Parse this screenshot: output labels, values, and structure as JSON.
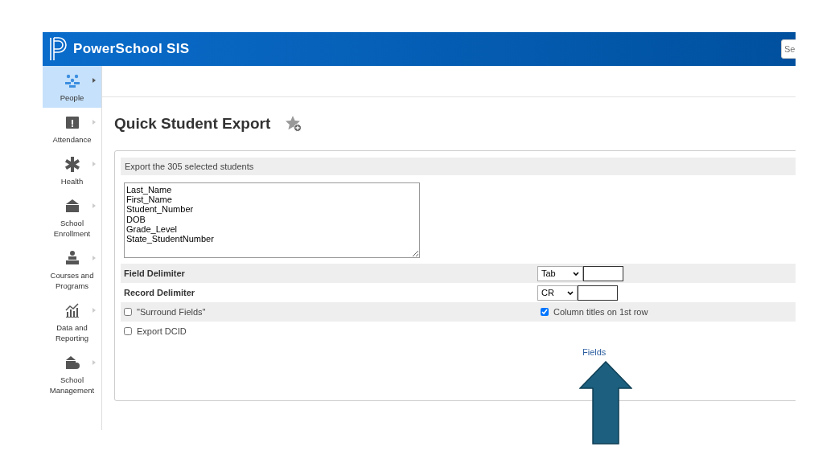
{
  "header": {
    "brand": "PowerSchool SIS",
    "search": {
      "placeholder": "Se"
    }
  },
  "sidebar": {
    "items": [
      {
        "label": "People",
        "selected": true
      },
      {
        "label": "Attendance",
        "selected": false
      },
      {
        "label": "Health",
        "selected": false
      },
      {
        "label": "School Enrollment",
        "selected": false
      },
      {
        "label": "Courses and Programs",
        "selected": false
      },
      {
        "label": "Data and Reporting",
        "selected": false
      },
      {
        "label": "School Management",
        "selected": false
      }
    ]
  },
  "page": {
    "title": "Quick Student Export"
  },
  "export": {
    "heading": "Export the 305 selected students",
    "fields": [
      "Last_Name",
      "First_Name",
      "Student_Number",
      "DOB",
      "Grade_Level",
      "State_StudentNumber"
    ],
    "field_delimiter": {
      "label": "Field Delimiter",
      "value": "Tab"
    },
    "record_delimiter": {
      "label": "Record Delimiter",
      "value": "CR"
    },
    "options": [
      {
        "label": "\"Surround Fields\"",
        "checked": false
      },
      {
        "label": "Column titles on 1st row",
        "checked": true
      },
      {
        "label": "Export DCID",
        "checked": false
      }
    ],
    "fields_link": "Fields"
  }
}
